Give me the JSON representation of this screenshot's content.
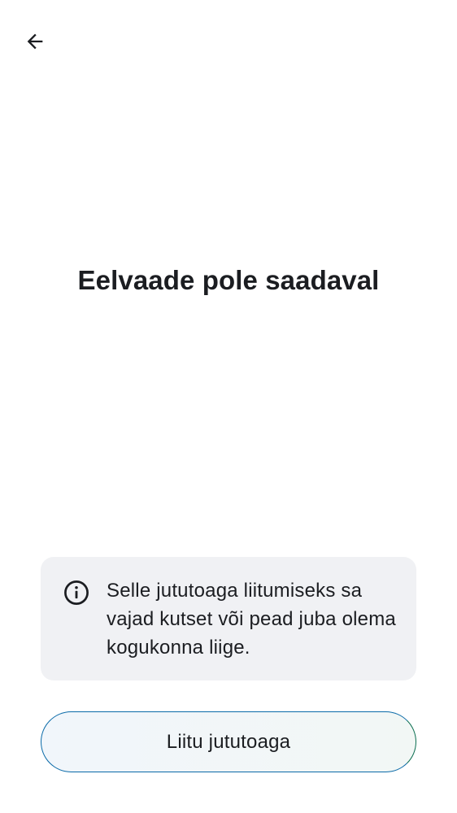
{
  "header": {
    "back_icon": "arrow-left-icon"
  },
  "main": {
    "title": "Eelvaade pole saadaval"
  },
  "info": {
    "icon": "info-icon",
    "text": "Selle jututoaga liitumiseks sa vajad kutset või pead juba olema kogukonna liige."
  },
  "actions": {
    "join_label": "Liitu jututoaga"
  },
  "colors": {
    "text": "#1b1d21",
    "card_background": "#f0f1f4",
    "button_border_left": "#0a6aa8",
    "button_border_right": "#0b6e50"
  }
}
